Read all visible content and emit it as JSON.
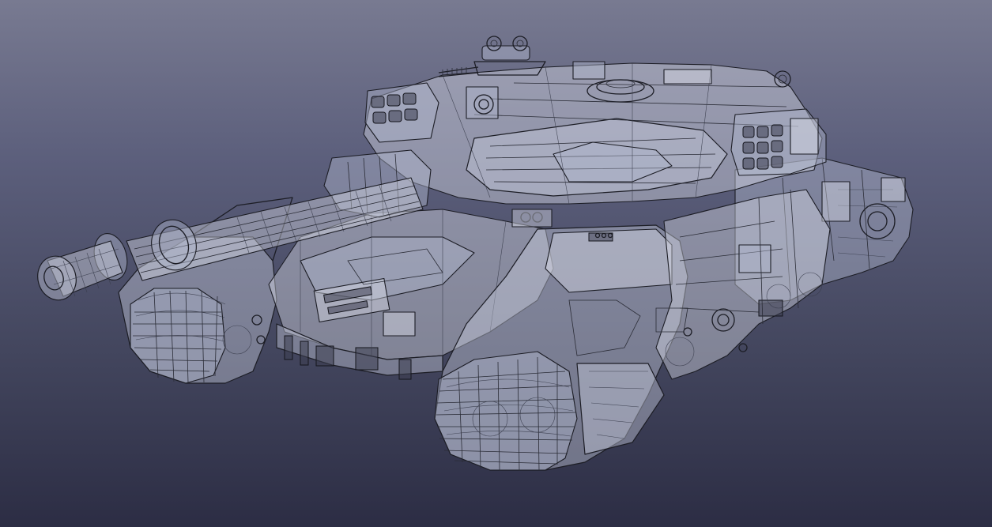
{
  "viewport": {
    "background_top": "#787a91",
    "background_bottom": "#2c2d44",
    "render_mode": "x-ray wireframe",
    "line_color": "#1c1d25",
    "surface_color": "#c8cdde"
  },
  "model": {
    "subject": "tank"
  }
}
